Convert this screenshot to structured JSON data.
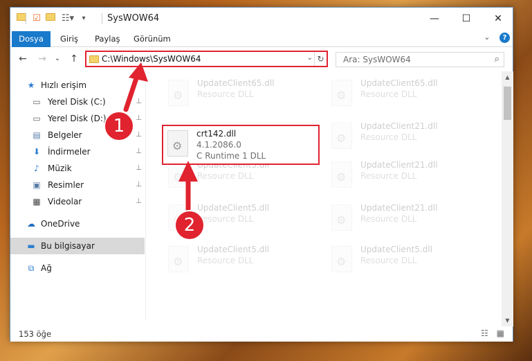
{
  "window": {
    "title": "SysWOW64",
    "minimize_glyph": "—",
    "maximize_glyph": "☐",
    "close_glyph": "✕"
  },
  "ribbon": {
    "tabs": [
      "Dosya",
      "Giriş",
      "Paylaş",
      "Görünüm"
    ],
    "expand_glyph": "⌄",
    "help_label": "?"
  },
  "address_bar": {
    "path": "C:\\Windows\\SysWOW64",
    "dropdown_glyph": "⌄",
    "refresh_glyph": "↻"
  },
  "search": {
    "placeholder": "Ara: SysWOW64",
    "icon": "⌕"
  },
  "nav_buttons": {
    "back": "←",
    "forward": "→",
    "recent": "⌄",
    "up": "↑"
  },
  "sidebar": {
    "items": [
      {
        "label": "Hızlı erişim",
        "icon": "star-icon",
        "glyph": "★"
      },
      {
        "label": "Yerel Disk (C:)",
        "icon": "drive-icon",
        "glyph": "▭",
        "pinned": true
      },
      {
        "label": "Yerel Disk (D:)",
        "icon": "drive-icon",
        "glyph": "▭",
        "pinned": true
      },
      {
        "label": "Belgeler",
        "icon": "documents-icon",
        "glyph": "▤",
        "pinned": true
      },
      {
        "label": "İndirmeler",
        "icon": "downloads-icon",
        "glyph": "⬇",
        "pinned": true
      },
      {
        "label": "Müzik",
        "icon": "music-icon",
        "glyph": "♪",
        "pinned": true
      },
      {
        "label": "Resimler",
        "icon": "pictures-icon",
        "glyph": "▣",
        "pinned": true
      },
      {
        "label": "Videolar",
        "icon": "videos-icon",
        "glyph": "▦",
        "pinned": true
      },
      {
        "label": "OneDrive",
        "icon": "cloud-icon",
        "glyph": "☁"
      },
      {
        "label": "Bu bilgisayar",
        "icon": "computer-icon",
        "glyph": "▬",
        "selected": true
      },
      {
        "label": "Ağ",
        "icon": "network-icon",
        "glyph": "⧉"
      }
    ],
    "pin_glyph": "📌"
  },
  "files": [
    {
      "name": "UpdateClient65.dll",
      "desc": "Resource DLL",
      "faded": true
    },
    {
      "name": "UpdateClient5.dll",
      "desc": "Resource DLL",
      "faded": true
    },
    {
      "name": "crt142.dll",
      "desc": "4.1.2086.0",
      "desc2": "C Runtime 1 DLL",
      "highlight": true
    },
    {
      "name": "UpdateClient21.dll",
      "desc": "Resource DLL",
      "faded": true
    },
    {
      "name": "UpdateClient5.dll",
      "desc": "Resource DLL",
      "faded": true
    },
    {
      "name": "UpdateClient21.dll",
      "desc": "Resource DLL",
      "faded": true
    },
    {
      "name": "UpdateClient5.dll",
      "desc": "Resource DLL",
      "faded": true
    },
    {
      "name": "UpdateClient21.dll",
      "desc": "Resource DLL",
      "faded": true
    },
    {
      "name": "UpdateClient5.dll",
      "desc": "Resource DLL",
      "faded": true
    },
    {
      "name": "UpdateClient65.dll",
      "desc": "Resource DLL",
      "faded": true
    }
  ],
  "status": {
    "item_count": "153 öğe",
    "view_glyphs": "☷ ▦"
  },
  "annotations": {
    "step1": "1",
    "step2": "2",
    "accent_color": "#e0232f"
  }
}
